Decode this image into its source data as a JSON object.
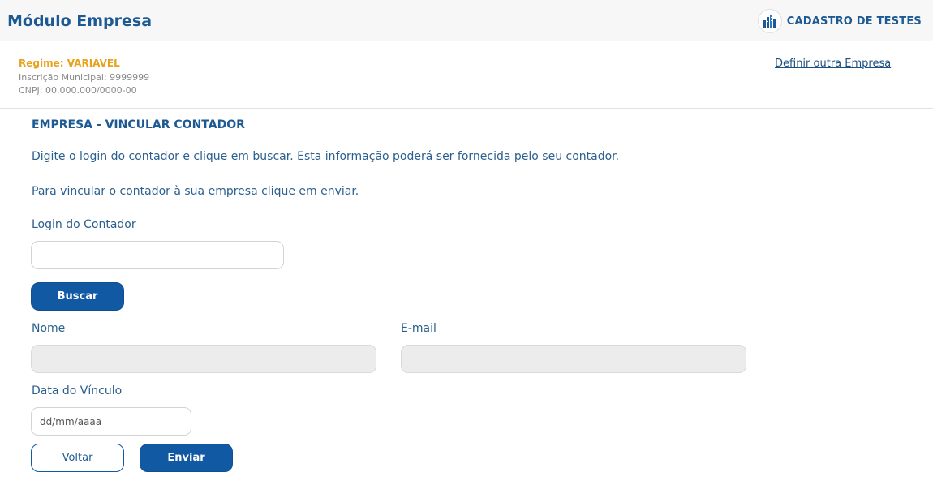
{
  "header": {
    "module_title": "Módulo Empresa",
    "brand_name": "CADASTRO DE TESTES",
    "brand_icon": "building-icon"
  },
  "company": {
    "regime": "Regime: VARIÁVEL",
    "inscricao": "Inscrição Municipal: 9999999",
    "cnpj": "CNPJ: 00.000.000/0000-00",
    "define_link": "Definir outra Empresa"
  },
  "main": {
    "section_title": "EMPRESA - VINCULAR CONTADOR",
    "instruction_1": "Digite o login do contador e clique em buscar. Esta informação poderá ser fornecida pelo seu contador.",
    "instruction_2": "Para vincular o contador à sua empresa clique em enviar.",
    "login_label": "Login do Contador",
    "login_value": "",
    "search_button": "Buscar",
    "name_label": "Nome",
    "name_value": "",
    "email_label": "E-mail",
    "email_value": "",
    "date_label": "Data do Vínculo",
    "date_placeholder": "dd/mm/aaaa",
    "back_button": "Voltar",
    "send_button": "Enviar"
  },
  "colors": {
    "primary": "#1159a3",
    "accent": "#e8a21b",
    "text": "#2a5f8e"
  }
}
